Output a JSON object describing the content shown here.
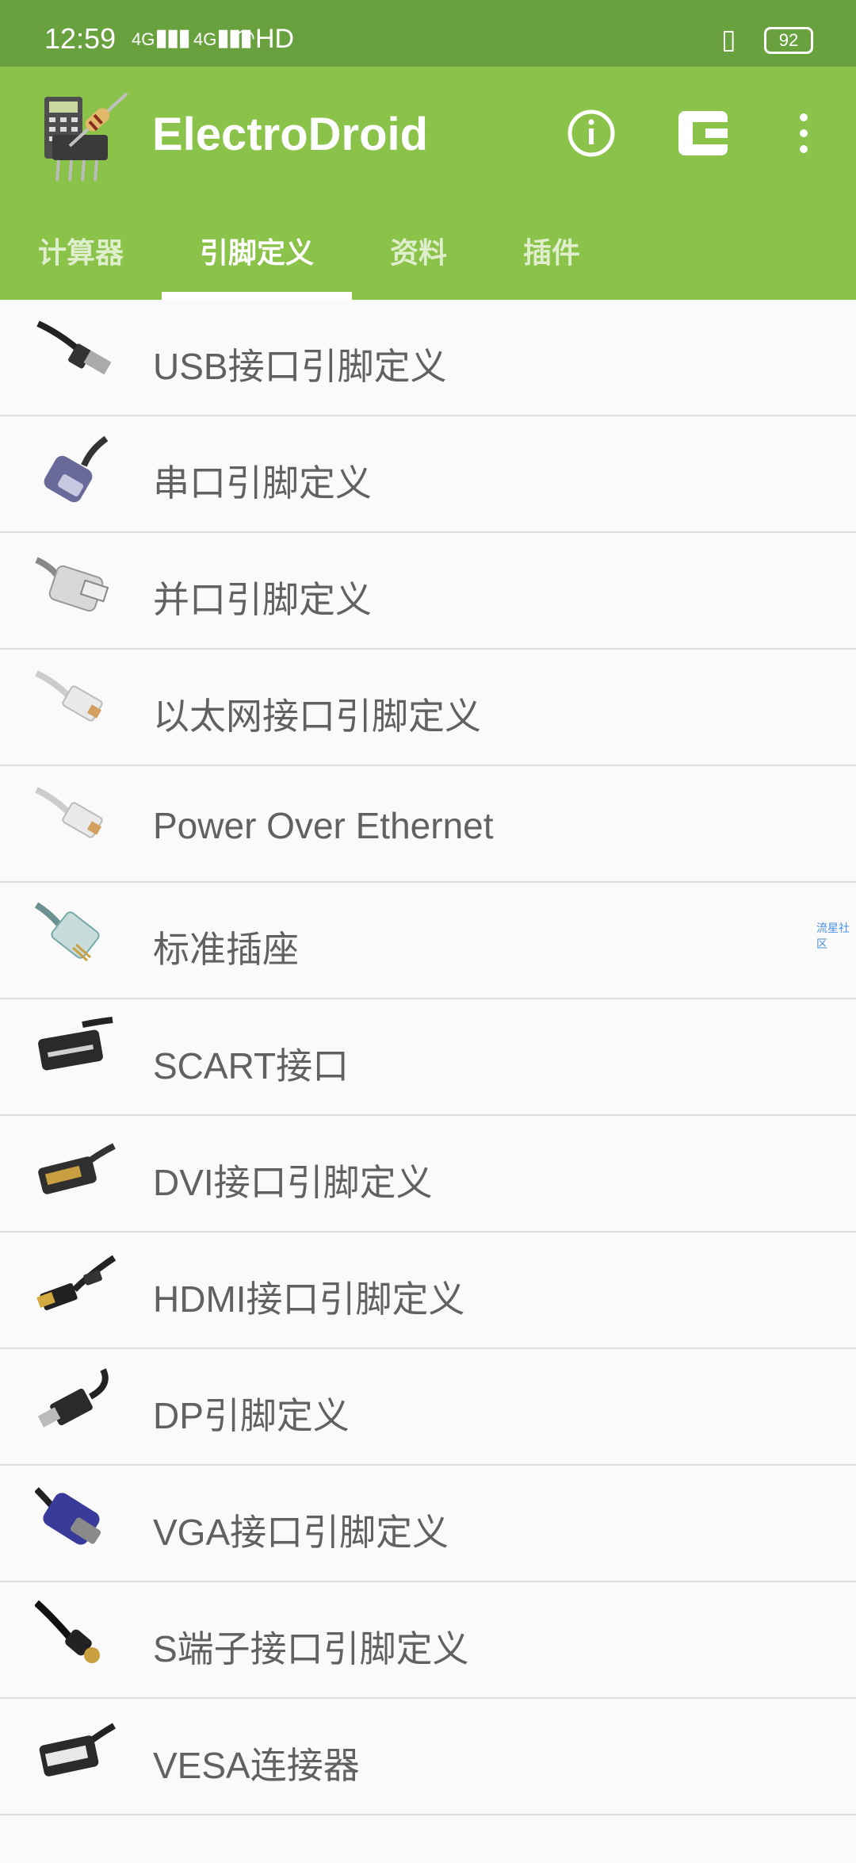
{
  "status_bar": {
    "time": "12:59",
    "signal1": "4G",
    "signal2": "4G",
    "hd": "HD",
    "battery": "92"
  },
  "appbar": {
    "title": "ElectroDroid",
    "icons": [
      "info-icon",
      "plugin-icon",
      "overflow-menu-icon"
    ]
  },
  "tabs": [
    "计算器",
    "引脚定义",
    "资料",
    "插件"
  ],
  "active_tab": 1,
  "list": [
    "USB接口引脚定义",
    "串口引脚定义",
    "并口引脚定义",
    "以太网接口引脚定义",
    "Power Over Ethernet",
    "标准插座",
    "SCART接口",
    "DVI接口引脚定义",
    "HDMI接口引脚定义",
    "DP引脚定义",
    "VGA接口引脚定义",
    "S端子接口引脚定义",
    "VESA连接器"
  ],
  "watermark": "流星社区",
  "colors": {
    "statusbar": "#6aa13f",
    "appbar": "#8bc34a",
    "text": "#616161",
    "divider": "#dedede"
  }
}
